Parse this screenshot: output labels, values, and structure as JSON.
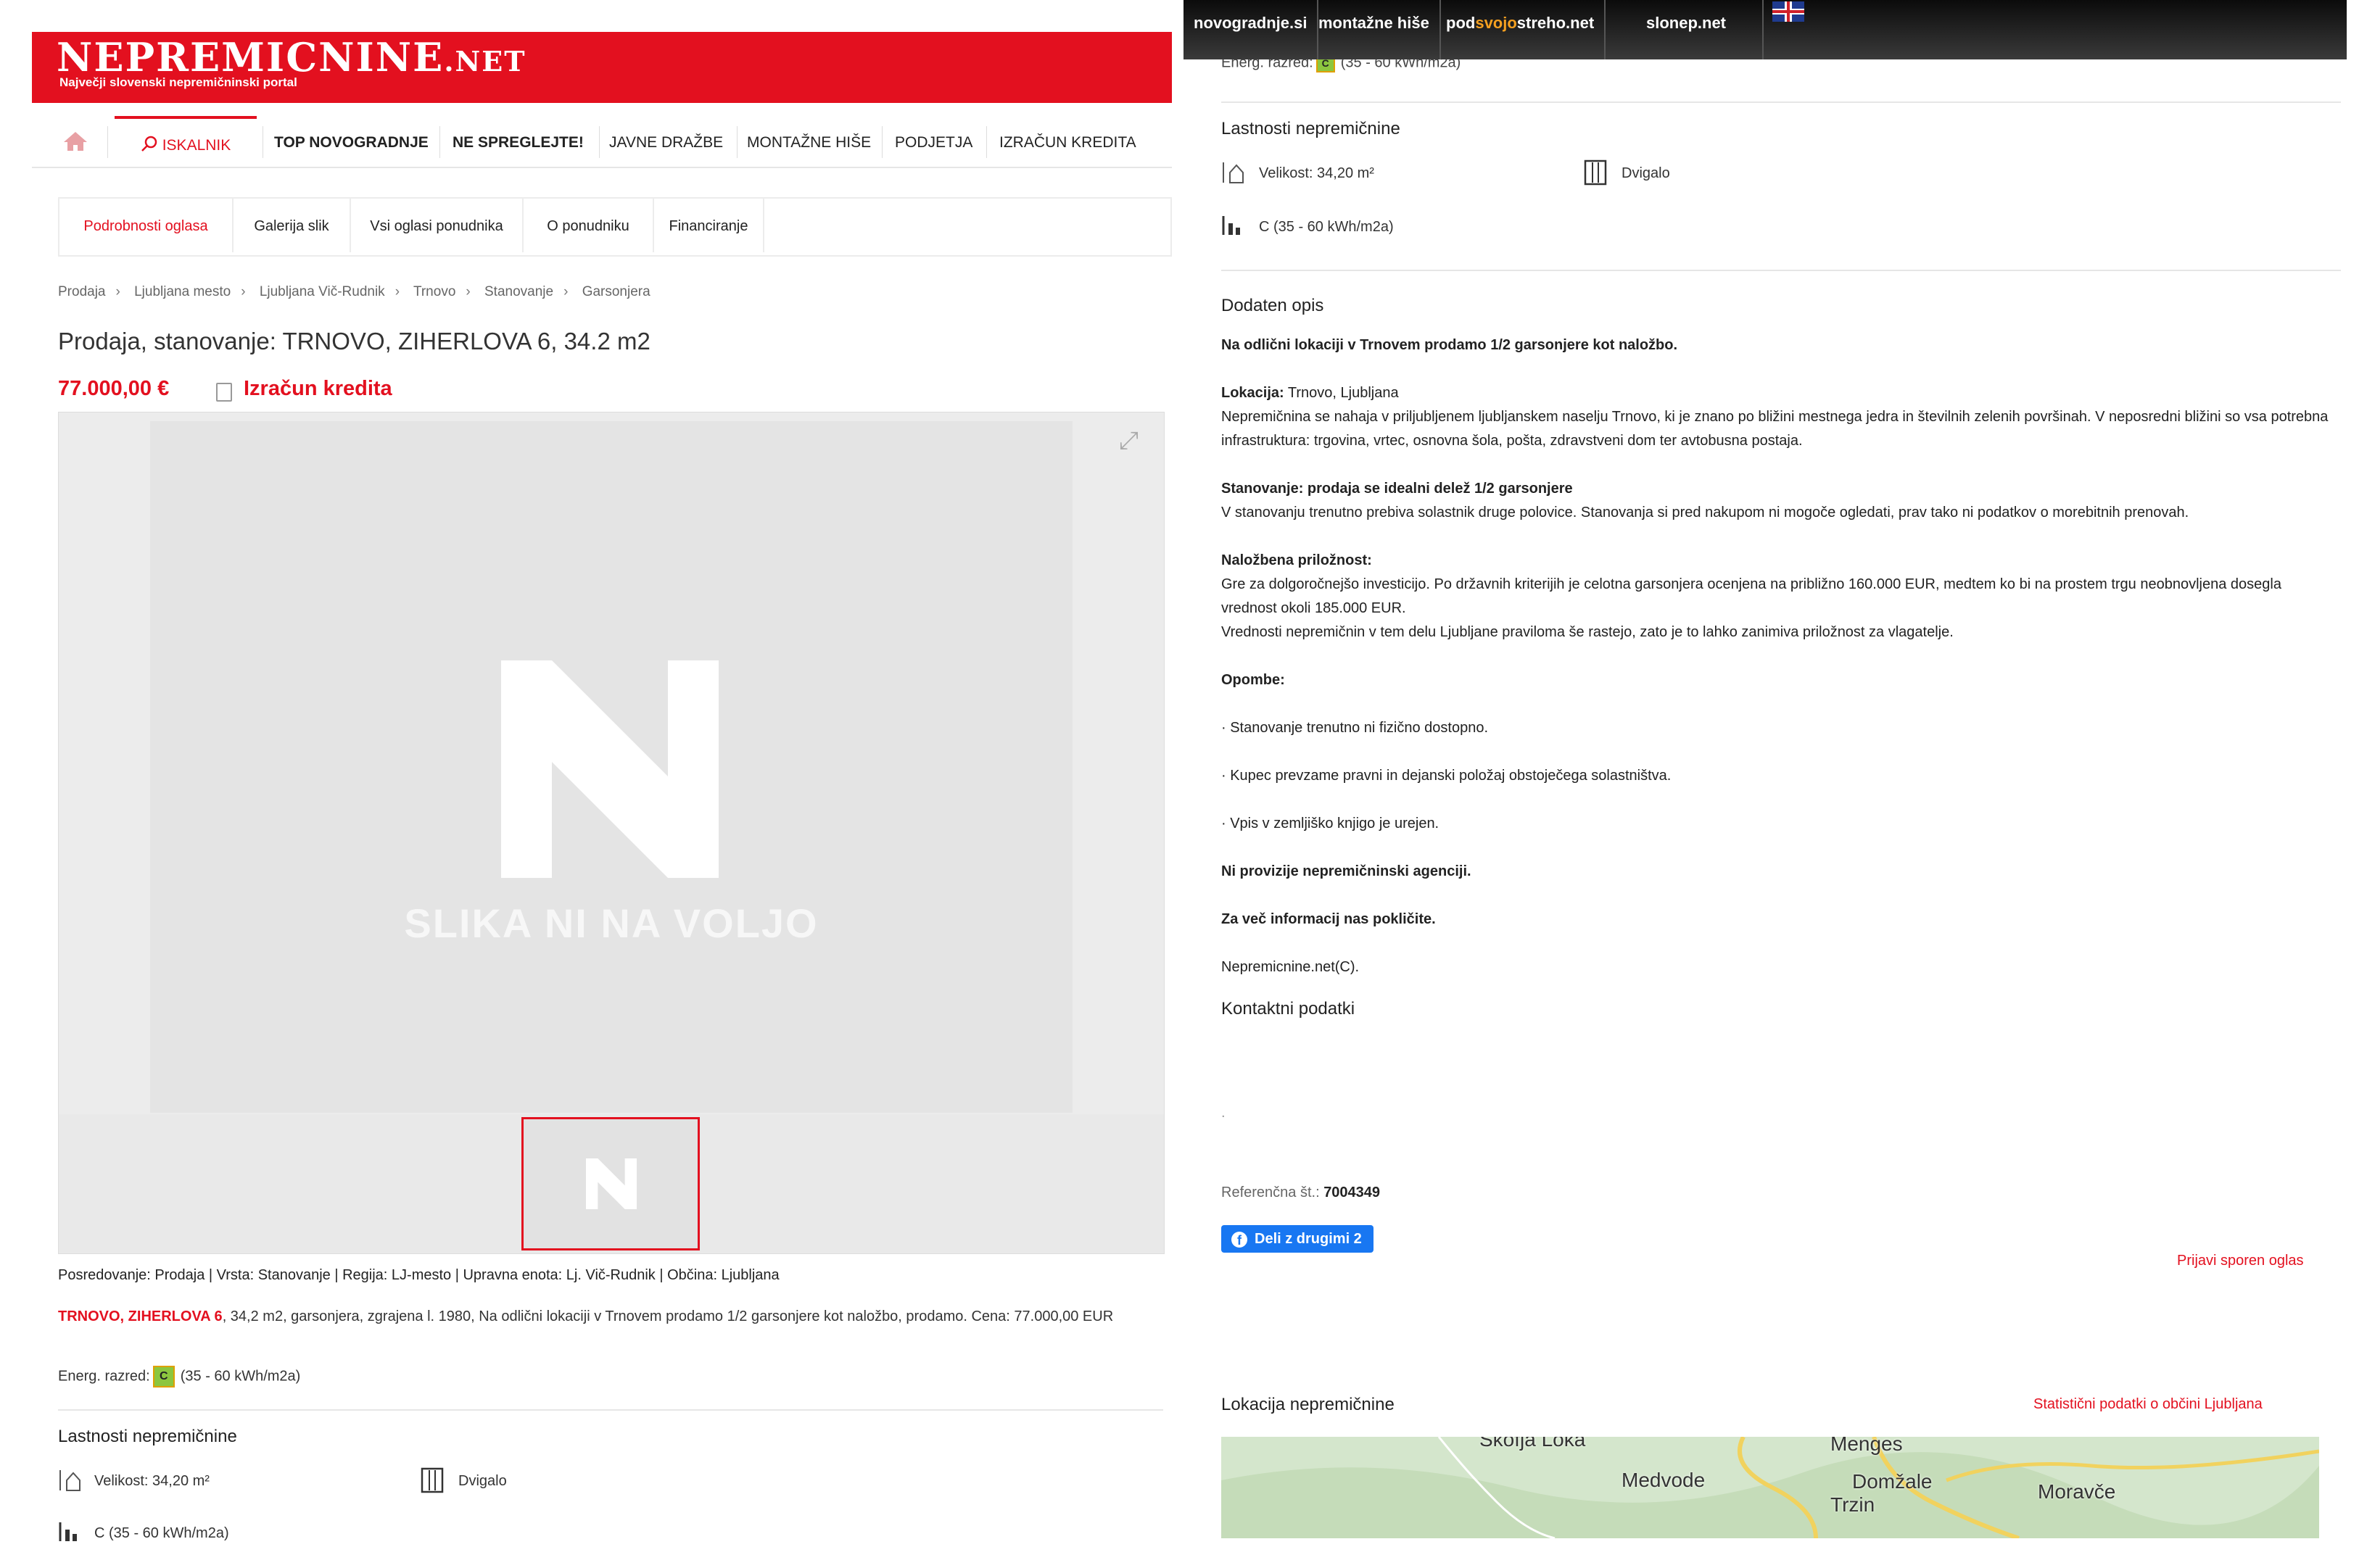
{
  "left": {
    "brand": {
      "name": "NEPREMICNINE",
      "tld": ".NET",
      "tagline": "Največji slovenski nepremičninski portal"
    },
    "nav": [
      "ISKALNIK",
      "TOP NOVOGRADNJE",
      "NE SPREGLEJTE!",
      "JAVNE DRAŽBE",
      "MONTAŽNE HIŠE",
      "PODJETJA",
      "IZRAČUN KREDITA"
    ],
    "tabs": [
      "Podrobnosti oglasa",
      "Galerija slik",
      "Vsi oglasi ponudnika",
      "O ponudniku",
      "Financiranje"
    ],
    "breadcrumb": [
      "Prodaja",
      "Ljubljana mesto",
      "Ljubljana Vič-Rudnik",
      "Trnovo",
      "Stanovanje",
      "Garsonjera"
    ],
    "title": "Prodaja, stanovanje: TRNOVO, ZIHERLOVA 6, 34.2 m2",
    "price": "77.000,00 €",
    "loan_label": "Izračun kredita",
    "no_image": "SLIKA NI NA VOLJO",
    "summary": "Posredovanje: Prodaja | Vrsta: Stanovanje | Regija: LJ-mesto | Upravna enota: Lj. Vič-Rudnik | Občina: Ljubljana",
    "desc_highlight": "TRNOVO, ZIHERLOVA 6",
    "desc_text": ", 34,2 m2, garsonjera, zgrajena l. 1980, Na odlični lokaciji v Trnovem prodamo 1/2 garsonjere kot naložbo, prodamo. Cena: 77.000,00 EUR",
    "energy_label": "Energ. razred:",
    "energy_class": "C",
    "energy_range": "(35 - 60 kWh/m2a)",
    "props_title": "Lastnosti nepremičnine",
    "size": "Velikost: 34,20 m²",
    "elevator": "Dvigalo",
    "energy_prop": "C (35 - 60 kWh/m2a)"
  },
  "right": {
    "topbar": {
      "novogradnje": "novogradnje.si",
      "montazne": "montažne hiše",
      "pod": "pod",
      "svojo": "svojo",
      "streho": "streho.net",
      "slonep": "slonep.net"
    },
    "energy_cut": "Energ. razred:",
    "energy_cut_range": "(35 - 60 kWh/m2a)",
    "props_title": "Lastnosti nepremičnine",
    "size": "Velikost: 34,20 m²",
    "elevator": "Dvigalo",
    "energy_prop": "C (35 - 60 kWh/m2a)",
    "add_desc_title": "Dodaten opis",
    "p1": "Na odlični lokaciji v Trnovem prodamo 1/2 garsonjere kot naložbo.",
    "lok_label": "Lokacija:",
    "lok_val": " Trnovo, Ljubljana",
    "lok_text": "Nepremičnina se nahaja v priljubljenem ljubljanskem naselju Trnovo, ki je znano po bližini mestnega jedra in številnih zelenih površinah. V neposredni bližini so vsa potrebna infrastruktura: trgovina, vrtec, osnovna šola, pošta, zdravstveni dom ter avtobusna postaja.",
    "stan_label": "Stanovanje: prodaja se idealni delež 1/2 garsonjere",
    "stan_text": "V stanovanju trenutno prebiva solastnik druge polovice. Stanovanja si pred nakupom ni mogoče ogledati, prav tako ni podatkov o morebitnih prenovah.",
    "nal_label": "Naložbena priložnost:",
    "nal_text1": "Gre za dolgoročnejšo investicijo. Po državnih kriterijih je celotna garsonjera ocenjena na približno 160.000 EUR, medtem ko bi na prostem trgu neobnovljena dosegla vrednost okoli 185.000 EUR.",
    "nal_text2": "Vrednosti nepremičnin v tem delu Ljubljane praviloma še rastejo, zato je to lahko zanimiva priložnost za vlagatelje.",
    "opombe": "Opombe:",
    "note1": "· Stanovanje trenutno ni fizično dostopno.",
    "note2": "· Kupec prevzame pravni in dejanski položaj obstoječega solastništva.",
    "note3": "· Vpis v zemljiško knjigo je urejen.",
    "no_prov": "Ni provizije nepremičninski agenciji.",
    "call": "Za več informacij nas pokličite.",
    "copyright": "Nepremicnine.net(C).",
    "contact_title": "Kontaktni podatki",
    "dot": ".",
    "ref_label": "Referenčna št.:",
    "ref_value": "7004349",
    "share": "Deli z drugimi 2",
    "report": "Prijavi sporen oglas",
    "map_title": "Lokacija nepremičnine",
    "stat_link": "Statistični podatki o občini Ljubljana",
    "map_towns": [
      "Škofja Loka",
      "Menges",
      "Medvode",
      "Domžale",
      "Trzin",
      "Moravče"
    ]
  },
  "colors": {
    "brand_red": "#e3101f",
    "fb_blue": "#1877f2",
    "energy_green": "#8cc63f"
  }
}
